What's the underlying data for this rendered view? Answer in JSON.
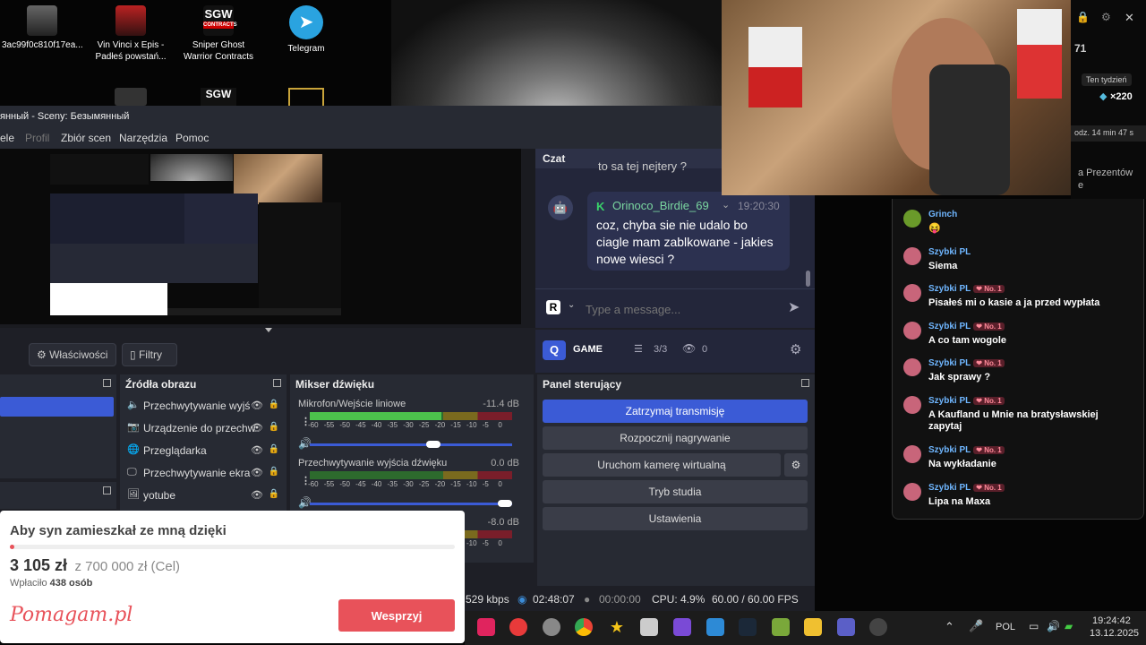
{
  "desktop": {
    "icons": [
      {
        "label": "3ac99f0c810f17ea...",
        "icon": "wolf-image-icon"
      },
      {
        "label": "Vin Vinci x Epis - Padłeś powstań...",
        "icon": "video-file-icon"
      },
      {
        "label": "Sniper Ghost Warrior Contracts",
        "icon": "sgw-game-icon"
      },
      {
        "label": "Telegram",
        "icon": "telegram-icon"
      }
    ]
  },
  "obs": {
    "title": "янный - Sceny: Безымянный",
    "menu": [
      "ele",
      "Profil",
      "Zbiór scen",
      "Narzędzia",
      "Pomoc"
    ],
    "properties_label": "Właściwości",
    "filters_label": "Filtry",
    "sources_title": "Źródła obrazu",
    "sources": [
      {
        "label": "Przechwytywanie wyjś",
        "icon": "speaker-icon"
      },
      {
        "label": "Urządzenie do przechw",
        "icon": "camera-icon"
      },
      {
        "label": "Przeglądarka",
        "icon": "globe-icon"
      },
      {
        "label": "Przechwytywanie ekra",
        "icon": "monitor-icon"
      },
      {
        "label": "yotube",
        "icon": "image-icon"
      }
    ],
    "mixer_title": "Mikser dźwięku",
    "mixer": [
      {
        "name": "Mikrofon/Wejście liniowe",
        "db": "-11.4 dB",
        "level": 0.65,
        "volume": 0.62
      },
      {
        "name": "Przechwytywanie wyjścia dźwięku",
        "db": "0.0 dB",
        "level": 0.0,
        "volume": 1.0
      },
      {
        "name": "",
        "db": "-8.0 dB",
        "level": 0.0,
        "volume": 0.0
      }
    ],
    "meter_ticks": [
      "-60",
      "-55",
      "-50",
      "-45",
      "-40",
      "-35",
      "-30",
      "-25",
      "-20",
      "-15",
      "-10",
      "-5",
      "0"
    ],
    "controls_title": "Panel sterujący",
    "controls": [
      "Zatrzymaj transmisję",
      "Rozpocznij nagrywanie",
      "Uruchom kamerę wirtualną",
      "Tryb studia",
      "Ustawienia"
    ],
    "status": {
      "kbps": "529 kbps",
      "stream_time": "02:48:07",
      "rec_time": "00:00:00",
      "cpu": "CPU: 4.9%",
      "fps": "60.00 / 60.00 FPS"
    }
  },
  "chat": {
    "title": "Czat",
    "prev_message": "to sa tej nejtery ?",
    "message": {
      "user": "Orinoco_Birdie_69",
      "time": "19:20:30",
      "text": "coz, chyba sie nie udalo bo ciagle mam zablkowane - jakies nowe wiesci ?"
    },
    "input_placeholder": "Type a message...",
    "channel": "GAME",
    "slots": "3/3",
    "viewers": "0"
  },
  "right_panel": {
    "count": "71",
    "period": "Ten tydzień",
    "points": "×220",
    "timer": "odz. 14 min 47 s",
    "gifts_text": "a Prezentów",
    "gifts_sub": "e"
  },
  "right_chat": [
    {
      "user": "Grinch",
      "badge": "",
      "text": "😝"
    },
    {
      "user": "Szybki",
      "badge": "",
      "text": "Siema"
    },
    {
      "user": "Szybki",
      "badge": "No. 1",
      "text": "Pisałeś mi o kasie a ja przed wypłata"
    },
    {
      "user": "Szybki",
      "badge": "No. 1",
      "text": "A co tam wogole"
    },
    {
      "user": "Szybki",
      "badge": "No. 1",
      "text": "Jak sprawy ?"
    },
    {
      "user": "Szybki",
      "badge": "No. 1",
      "text": "A Kaufland u Mnie na bratysławskiej zapytaj"
    },
    {
      "user": "Szybki",
      "badge": "No. 1",
      "text": "Na wykładanie"
    },
    {
      "user": "Szybki",
      "badge": "No. 1",
      "text": "Lipa na Maxa"
    }
  ],
  "right_chat_suffix": "PL",
  "donation": {
    "title": "Aby syn zamieszkał ze mną dzięki",
    "amount": "3 105 zł",
    "goal": "z 700 000 zł (Cel)",
    "donors_prefix": "Wpłaciło",
    "donors": "438 osób",
    "progress": 0.0044,
    "brand": "Pomagam.pl",
    "button": "Wesprzyj"
  },
  "taskbar": {
    "language": "POL",
    "time": "19:24:42",
    "date": "13.12.2025"
  }
}
